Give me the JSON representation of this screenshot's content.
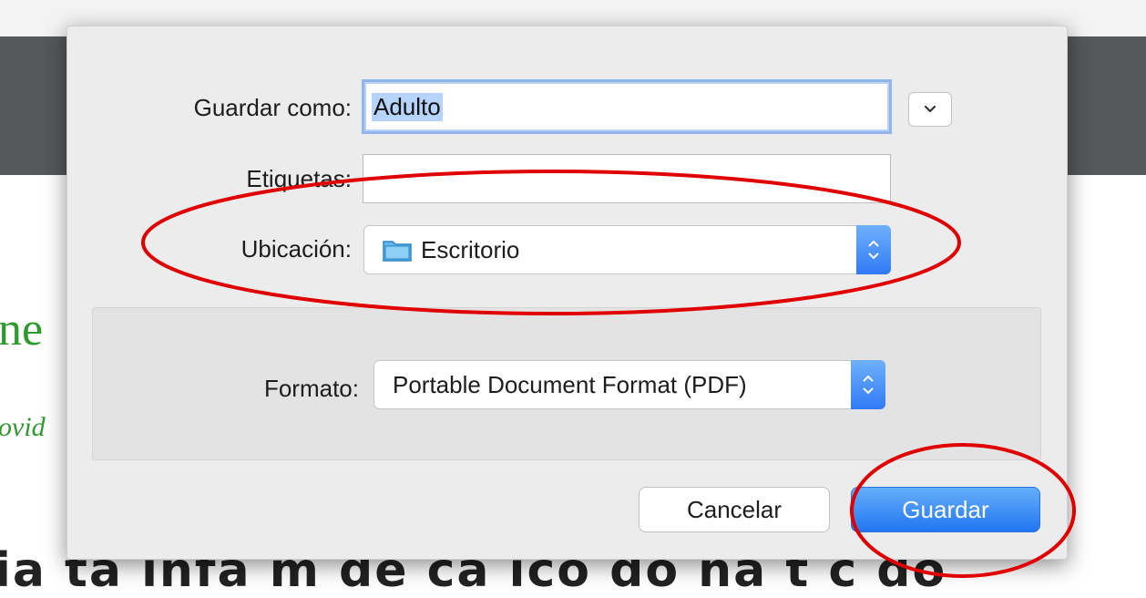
{
  "background": {
    "heading_fragment": "ne",
    "italic_fragment": "ovid",
    "bottom_fragment": "ia ta  infa  m de  ca  ico  do  ná  t  c  do  "
  },
  "dialog": {
    "save_as_label": "Guardar como:",
    "save_as_value": "Adulto",
    "tags_label": "Etiquetas:",
    "tags_value": "",
    "location_label": "Ubicación:",
    "location_value": "Escritorio",
    "location_icon": "folder-icon",
    "format_label": "Formato:",
    "format_value": "Portable Document Format (PDF)",
    "cancel_label": "Cancelar",
    "save_label": "Guardar"
  },
  "colors": {
    "accent": "#2f7bf5",
    "annotation": "#e00000"
  }
}
